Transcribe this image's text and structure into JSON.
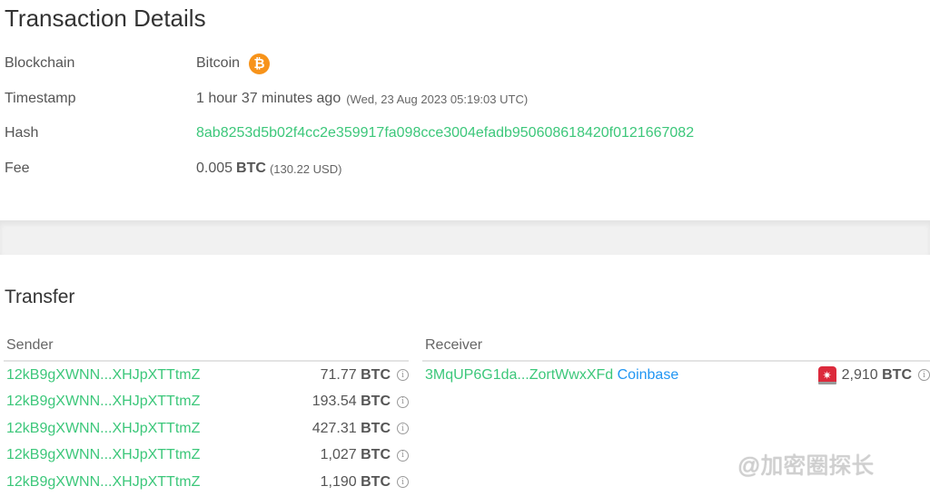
{
  "title": "Transaction Details",
  "details": {
    "blockchain": {
      "label": "Blockchain",
      "value": "Bitcoin",
      "icon": "bitcoin-icon"
    },
    "timestamp": {
      "label": "Timestamp",
      "relative": "1 hour 37 minutes ago",
      "absolute": "(Wed, 23 Aug 2023 05:19:03 UTC)"
    },
    "hash": {
      "label": "Hash",
      "value": "8ab8253d5b02f4cc2e359917fa098cce3004efadb950608618420f0121667082"
    },
    "fee": {
      "label": "Fee",
      "amount": "0.005",
      "unit": "BTC",
      "usd": "(130.22 USD)"
    }
  },
  "transfer": {
    "heading": "Transfer",
    "sender_header": "Sender",
    "receiver_header": "Receiver",
    "senders": [
      {
        "address": "12kB9gXWNN...XHJpXTTtmZ",
        "amount": "71.77",
        "unit": "BTC"
      },
      {
        "address": "12kB9gXWNN...XHJpXTTtmZ",
        "amount": "193.54",
        "unit": "BTC"
      },
      {
        "address": "12kB9gXWNN...XHJpXTTtmZ",
        "amount": "427.31",
        "unit": "BTC"
      },
      {
        "address": "12kB9gXWNN...XHJpXTTtmZ",
        "amount": "1,027",
        "unit": "BTC"
      },
      {
        "address": "12kB9gXWNN...XHJpXTTtmZ",
        "amount": "1,190",
        "unit": "BTC"
      }
    ],
    "receivers": [
      {
        "address": "3MqUP6G1da...ZortWwxXFd",
        "entity": "Coinbase",
        "amount": "2,910",
        "unit": "BTC",
        "icon": "alarm-icon"
      }
    ]
  },
  "watermark": "@加密圈探长",
  "colors": {
    "link_green": "#3cc77a",
    "entity_blue": "#2196f3",
    "bitcoin_orange": "#f7931a",
    "alarm_red": "#dc2a3c"
  }
}
